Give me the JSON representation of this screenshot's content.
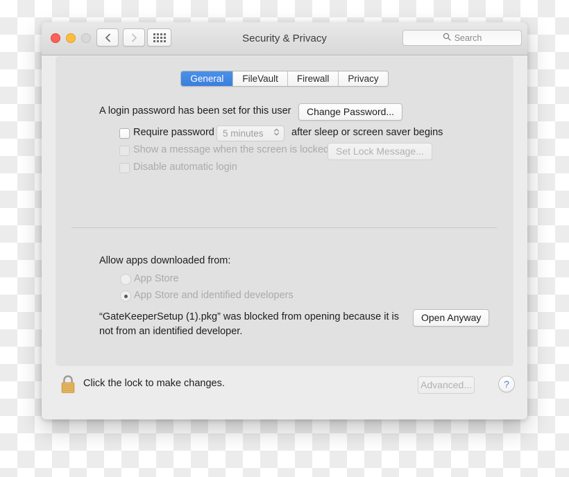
{
  "window": {
    "title": "Security & Privacy",
    "traffic_lights": [
      "close-red",
      "minimize-yellow",
      "zoom-grey-disabled"
    ],
    "nav": {
      "back_icon": "chevron-left-icon",
      "forward_icon": "chevron-right-icon",
      "grid_icon": "show-all-grid-icon"
    },
    "search": {
      "placeholder": "Search",
      "icon": "search-icon"
    }
  },
  "tabs": [
    {
      "label": "General",
      "selected": true
    },
    {
      "label": "FileVault",
      "selected": false
    },
    {
      "label": "Firewall",
      "selected": false
    },
    {
      "label": "Privacy",
      "selected": false
    }
  ],
  "general": {
    "password_status": "A login password has been set for this user",
    "change_password_button": "Change Password...",
    "require_password": {
      "label": "Require password",
      "checked": false,
      "enabled": true,
      "interval": "5 minutes",
      "interval_enabled": false,
      "suffix": "after sleep or screen saver begins"
    },
    "show_message": {
      "label": "Show a message when the screen is locked",
      "checked": false,
      "enabled": false,
      "button": "Set Lock Message...",
      "button_enabled": false
    },
    "disable_auto_login": {
      "label": "Disable automatic login",
      "checked": false,
      "enabled": false
    }
  },
  "gatekeeper": {
    "heading": "Allow apps downloaded from:",
    "options": [
      {
        "label": "App Store",
        "selected": false,
        "enabled": false
      },
      {
        "label": "App Store and identified developers",
        "selected": true,
        "enabled": false
      }
    ],
    "blocked_message_line1": "“GateKeeperSetup (1).pkg” was blocked from opening because it is",
    "blocked_message_line2": "not from an identified developer.",
    "open_anyway_button": "Open Anyway"
  },
  "footer": {
    "lock_icon": "lock-closed-icon",
    "lock_text": "Click the lock to make changes.",
    "advanced_button": "Advanced...",
    "advanced_enabled": false,
    "help_button": "?"
  },
  "colors": {
    "accent_blue": "#3b7fdd",
    "panel_bg": "#e1e1e1",
    "window_bg": "#ececec",
    "lock_body": "#e8b860",
    "help_blue": "#4a7fd4"
  }
}
